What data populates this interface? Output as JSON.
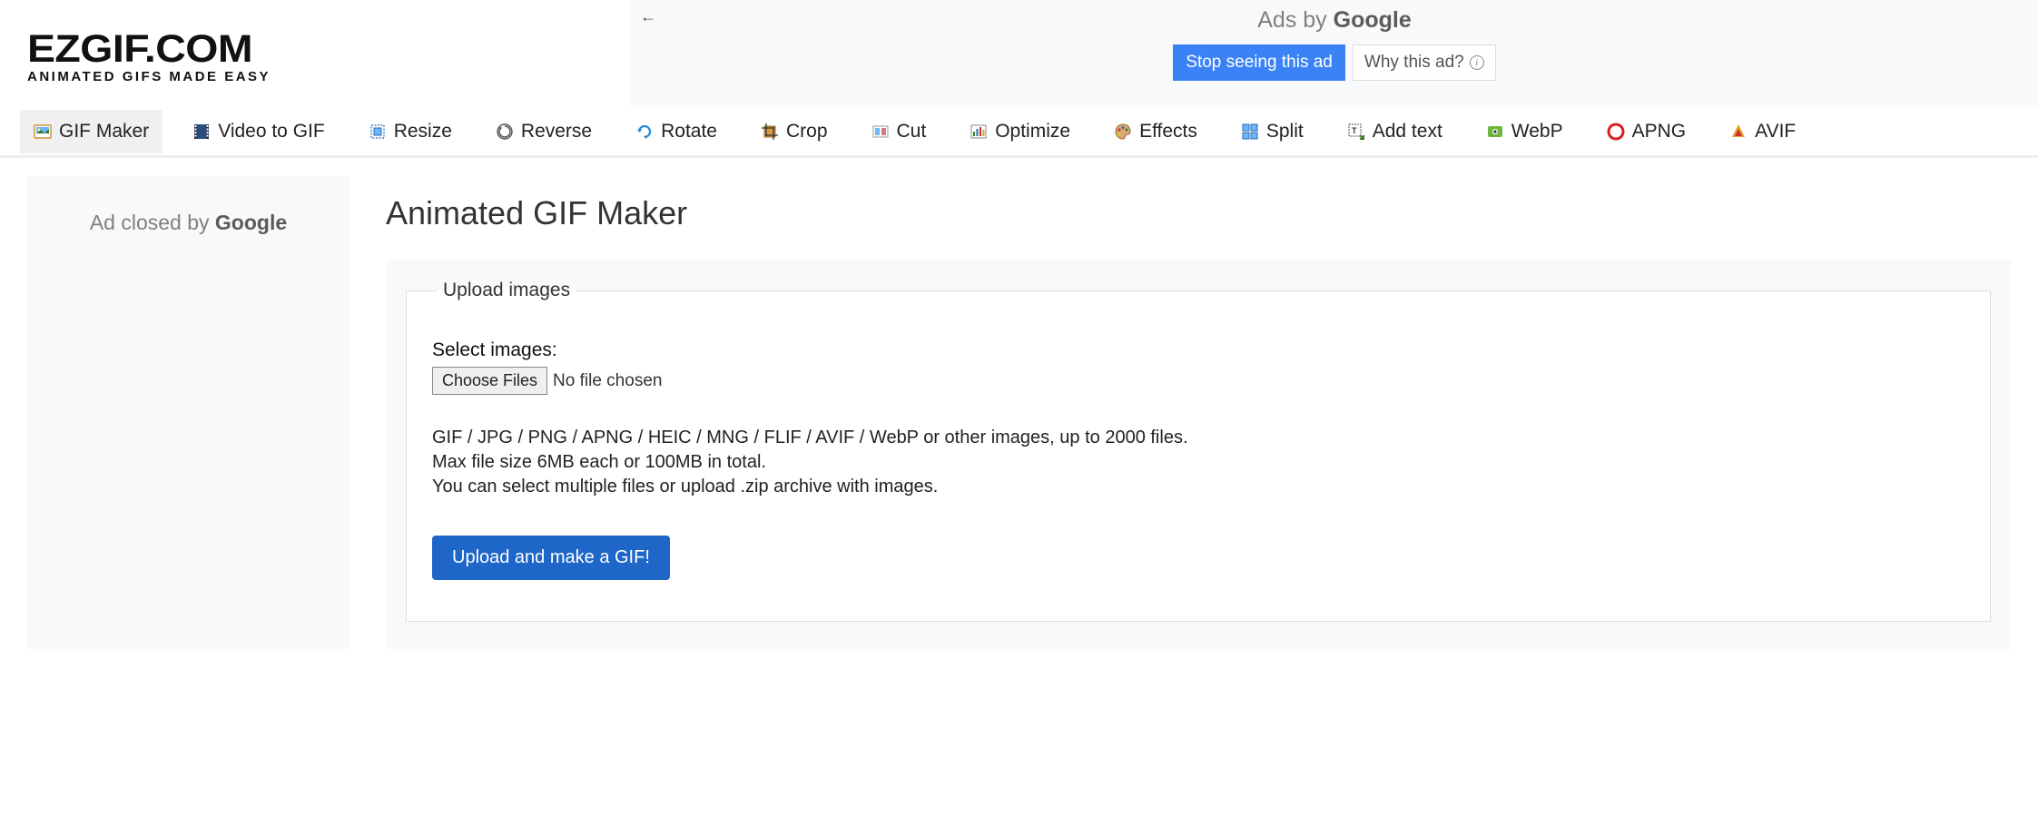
{
  "logo": {
    "main": "EZGIF.COM",
    "sub": "ANIMATED GIFS MADE EASY"
  },
  "ad_top": {
    "label_prefix": "Ads by ",
    "label_brand": "Google",
    "stop": "Stop seeing this ad",
    "why": "Why this ad?"
  },
  "nav": [
    {
      "key": "gifmaker",
      "label": "GIF Maker",
      "active": true
    },
    {
      "key": "video",
      "label": "Video to GIF"
    },
    {
      "key": "resize",
      "label": "Resize"
    },
    {
      "key": "reverse",
      "label": "Reverse"
    },
    {
      "key": "rotate",
      "label": "Rotate"
    },
    {
      "key": "crop",
      "label": "Crop"
    },
    {
      "key": "cut",
      "label": "Cut"
    },
    {
      "key": "optimize",
      "label": "Optimize"
    },
    {
      "key": "effects",
      "label": "Effects"
    },
    {
      "key": "split",
      "label": "Split"
    },
    {
      "key": "addtext",
      "label": "Add text"
    },
    {
      "key": "webp",
      "label": "WebP"
    },
    {
      "key": "apng",
      "label": "APNG"
    },
    {
      "key": "avif",
      "label": "AVIF"
    }
  ],
  "sidebar_ad": {
    "prefix": "Ad closed by ",
    "brand": "Google"
  },
  "page": {
    "title": "Animated GIF Maker",
    "legend": "Upload images",
    "select_label": "Select images:",
    "choose_btn": "Choose Files",
    "file_status": "No file chosen",
    "help1": "GIF / JPG / PNG / APNG / HEIC / MNG / FLIF / AVIF / WebP or other images, up to 2000 files.",
    "help2": "Max file size 6MB each or 100MB in total.",
    "help3": "You can select multiple files or upload .zip archive with images.",
    "submit": "Upload and make a GIF!"
  }
}
